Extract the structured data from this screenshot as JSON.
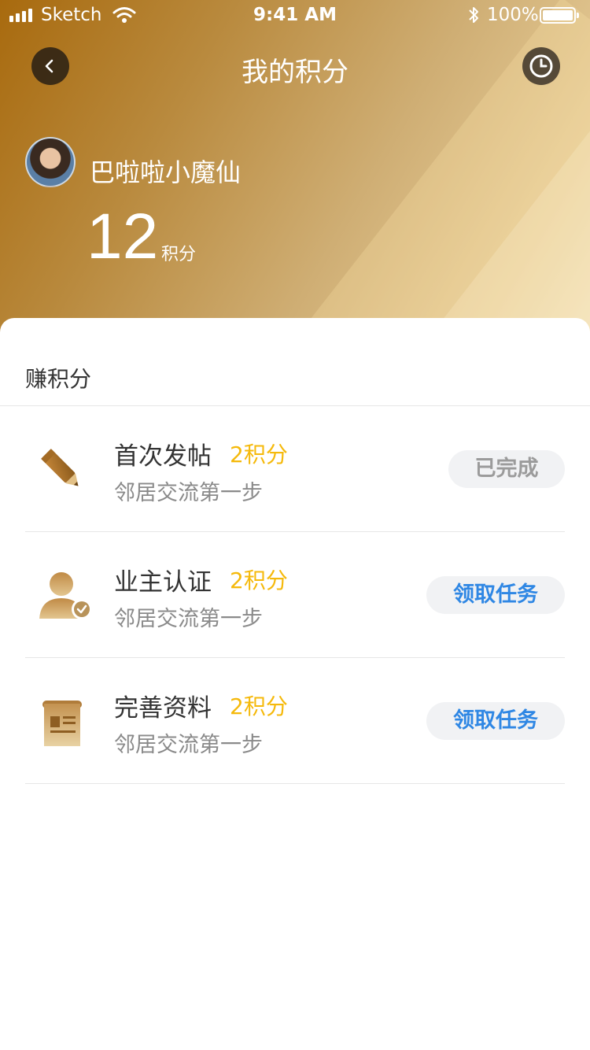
{
  "status_bar": {
    "carrier": "Sketch",
    "time": "9:41 AM",
    "battery": "100%"
  },
  "nav": {
    "back_icon": "chevron-left-icon",
    "title": "我的积分",
    "history_icon": "clock-icon"
  },
  "profile": {
    "username": "巴啦啦小魔仙",
    "points": "12",
    "points_unit": "积分"
  },
  "section": {
    "title": "赚积分"
  },
  "tasks": [
    {
      "name": "首次发帖",
      "points": "2积分",
      "desc": "邻居交流第一步",
      "action": "已完成",
      "icon": "pencil-icon",
      "status": "done"
    },
    {
      "name": "业主认证",
      "points": "2积分",
      "desc": "邻居交流第一步",
      "action": "领取任务",
      "icon": "user-verified-icon",
      "status": "available"
    },
    {
      "name": "完善资料",
      "points": "2积分",
      "desc": "邻居交流第一步",
      "action": "领取任务",
      "icon": "document-scroll-icon",
      "status": "available"
    }
  ],
  "colors": {
    "accent_gold": "#f5b90b",
    "action_blue": "#2f87e4",
    "header_gradient_start": "#a86a0e",
    "header_gradient_end": "#efe0bd"
  }
}
